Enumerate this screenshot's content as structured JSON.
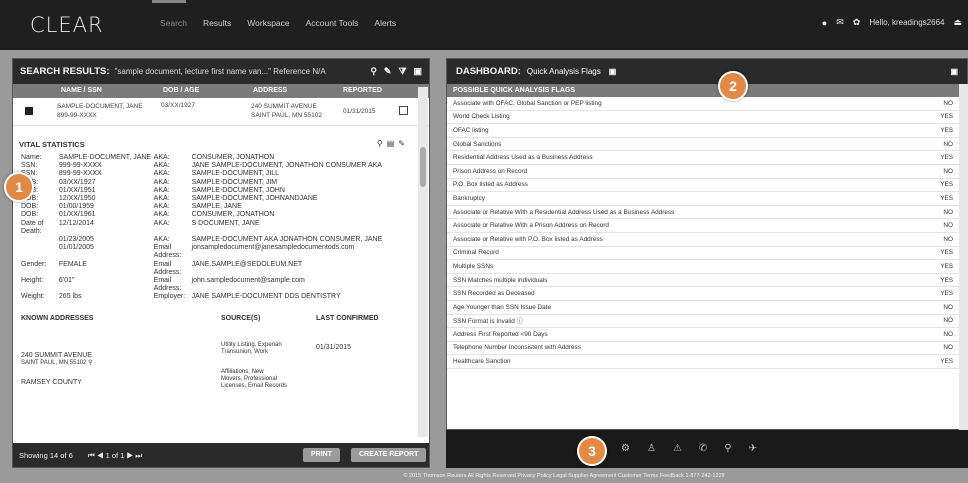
{
  "app": {
    "logo": "CLEAR",
    "nav": [
      "Search",
      "Results",
      "Workspace",
      "Account Tools",
      "Alerts"
    ],
    "user_greeting": "Hello, kreadings2664"
  },
  "search_results": {
    "title": "SEARCH RESULTS:",
    "query": "\"sample document, lecture first name van...\" Reference N/A",
    "columns": [
      "NAME / SSN",
      "DOB / AGE",
      "ADDRESS",
      "REPORTED"
    ],
    "row": {
      "name": "SAMPLE-DOCUMENT, JANE",
      "ssn": "899-99-XXXX",
      "dob": "03/XX/1927",
      "addr1": "240 SUMMIT AVENUE",
      "addr2": "SAINT PAUL, MN 55102",
      "reported": "01/31/2015"
    }
  },
  "vital": {
    "title": "VITAL STATISTICS",
    "left": [
      {
        "k": "Name:",
        "v": "SAMPLE-DOCUMENT, JANE"
      },
      {
        "k": "SSN:",
        "v": "999-99-XXXX"
      },
      {
        "k": "SSN:",
        "v": "899-99-XXXX"
      },
      {
        "k": "DOB:",
        "v": "03/XX/1927"
      },
      {
        "k": "DOB:",
        "v": "01/XX/1951"
      },
      {
        "k": "DOB:",
        "v": "12/XX/1950"
      },
      {
        "k": "DOB:",
        "v": "01/00/1959"
      },
      {
        "k": "DOB:",
        "v": "01/XX/1961"
      },
      {
        "k": "Date of Death:",
        "v": "12/12/2014"
      },
      {
        "k": "",
        "v": "01/23/2005"
      },
      {
        "k": "",
        "v": "01/01/2005"
      },
      {
        "k": "Gender:",
        "v": "FEMALE"
      },
      {
        "k": "Height:",
        "v": "6'01\""
      },
      {
        "k": "Weight:",
        "v": "265 lbs"
      }
    ],
    "right": [
      {
        "k": "AKA:",
        "v": "CONSUMER, JONATHON"
      },
      {
        "k": "AKA:",
        "v": "JANE SAMPLE-DOCUMENT, JONATHON CONSUMER AKA"
      },
      {
        "k": "AKA:",
        "v": "SAMPLE-DOCUMENT, JILL"
      },
      {
        "k": "AKA:",
        "v": "SAMPLE-DOCUMENT, JIM"
      },
      {
        "k": "AKA:",
        "v": "SAMPLE-DOCUMENT, JOHN"
      },
      {
        "k": "AKA:",
        "v": "SAMPLE-DOCUMENT, JOHNANDJANE"
      },
      {
        "k": "AKA:",
        "v": "SAMPLE, JANE"
      },
      {
        "k": "AKA:",
        "v": "CONSUMER, JONATHON"
      },
      {
        "k": "AKA:",
        "v": "S DOCUMENT, JANE"
      },
      {
        "k": "AKA:",
        "v": "SAMPLE-DOCUMENT AKA JONATHON CONSUMER, JANE"
      },
      {
        "k": "Email Address:",
        "v": "jonsampledocument@janesampledocumentods.com"
      },
      {
        "k": "Email Address:",
        "v": "JANE.SAMPLE@SEDOLEUM.NET"
      },
      {
        "k": "Email Address:",
        "v": "john.sampledocument@sample.com"
      },
      {
        "k": "Employer:",
        "v": "JANE SAMPLE-DOCUMENT DDS DENTISTRY"
      }
    ]
  },
  "known_addresses": {
    "headers": [
      "KNOWN ADDRESSES",
      "SOURCE(S)",
      "LAST CONFIRMED"
    ],
    "addr_lines": [
      "240 SUMMIT AVENUE",
      "SAINT PAUL, MN 55102 ⚲",
      "RAMSEY COUNTY"
    ],
    "sources": [
      "Utility Listing, Experian",
      "Transunion, Work",
      "Affiliations, New",
      "Movers, Professional",
      "Licenses, Email Records"
    ],
    "confirmed": "01/31/2015"
  },
  "left_footer": {
    "showing": "Showing 14 of 6",
    "pager": "⏮ ◀ 1 of 1 ▶ ⏭",
    "print": "PRINT",
    "create": "CREATE REPORT"
  },
  "dashboard": {
    "title": "DASHBOARD:",
    "subtitle": "Quick Analysis Flags",
    "flag_header": "POSSIBLE QUICK ANALYSIS FLAGS",
    "flags": [
      {
        "label": "Associate with OFAC, Global Sanction or PEP listing",
        "value": "NO"
      },
      {
        "label": "World Check Listing",
        "value": "YES"
      },
      {
        "label": "OFAC listing",
        "value": "YES"
      },
      {
        "label": "Global Sanctions",
        "value": "NO"
      },
      {
        "label": "Residential Address Used as a Business Address",
        "value": "YES"
      },
      {
        "label": "Prison Address on Record",
        "value": "NO"
      },
      {
        "label": "P.O. Box listed as Address",
        "value": "YES"
      },
      {
        "label": "Bankruptcy",
        "value": "YES"
      },
      {
        "label": "Associate or Relative With a Residential Address Used as a Business Address",
        "value": "NO"
      },
      {
        "label": "Associate or Relative With a Prison Address on Record",
        "value": "NO"
      },
      {
        "label": "Associate or Relative with P.O. Box listed as Address",
        "value": "NO"
      },
      {
        "label": "Criminal Record",
        "value": "YES"
      },
      {
        "label": "Multiple SSNs",
        "value": "YES"
      },
      {
        "label": "SSN Matches multiple individuals",
        "value": "YES"
      },
      {
        "label": "SSN Recorded as Deceased",
        "value": "YES"
      },
      {
        "label": "Age Younger than SSN Issue Date",
        "value": "NO"
      },
      {
        "label": "SSN Format is Invalid ⓘ",
        "value": "NO"
      },
      {
        "label": "Address First Reported <90 Days",
        "value": "NO"
      },
      {
        "label": "Telephone Number Inconsistent with Address",
        "value": "NO"
      },
      {
        "label": "Healthcare Sanction",
        "value": "YES"
      }
    ]
  },
  "badges": [
    "1",
    "2",
    "3"
  ],
  "footer_icons": [
    "settings-icon",
    "person-icon",
    "alert-icon",
    "phone-icon",
    "pin-icon",
    "plane-icon"
  ],
  "copyright": "© 2015 Thomson Reuters  All Rights Reserved  Privacy Policy  Legal  Supplier Agreement  Customer Terms  Feedback  1-877-242-1229"
}
